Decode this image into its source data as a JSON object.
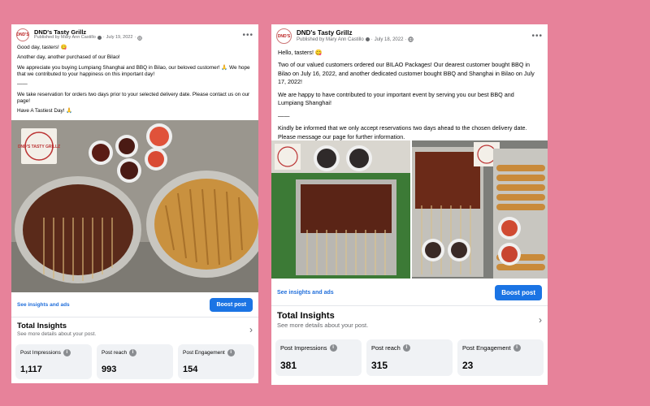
{
  "posts": [
    {
      "page_name": "DND's Tasty Grillz",
      "published_by": "Published by Mary Ann Castillo",
      "date": "July 19, 2022",
      "logo_text": "DND'S",
      "paragraphs": [
        "Good day, tasters! 😋",
        "Another day, another purchased of our Bilao!",
        "We appreciate you buying Lumpiang Shanghai and BBQ in Bilao, our beloved customer! 🙏 We hope that we contributed to your happiness on this important day!",
        "——",
        "We take reservation for orders two days prior to your selected delivery date. Please contact us on our page!",
        "Have A Tastiest Day! 🙏"
      ],
      "photo_logo_text": "DND'S TASTY GRILLZ",
      "see_insights": "See insights and ads",
      "boost_label": "Boost post",
      "total_title": "Total Insights",
      "total_sub": "See more details about your post.",
      "stats": [
        {
          "label": "Post Impressions",
          "value": "1,117"
        },
        {
          "label": "Post reach",
          "value": "993"
        },
        {
          "label": "Post Engagement",
          "value": "154"
        }
      ]
    },
    {
      "page_name": "DND's Tasty Grillz",
      "published_by": "Published by Mary Ann Castillo",
      "date": "July 18, 2022",
      "logo_text": "DND'S",
      "paragraphs": [
        "Hello, tasters! 😋",
        "Two of our valued customers ordered our BILAO Packages! Our dearest customer bought BBQ in Bilao on July 16, 2022, and another dedicated customer bought BBQ and Shanghai in Bilao on July 17, 2022!",
        "We are happy to have contributed to your important event by serving you our best BBQ and Lumpiang Shanghai!",
        "——",
        "Kindly be informed that we only accept reservations two days ahead to the chosen delivery date. Please message our page for further information."
      ],
      "photo_logo_text": "DND'S TASTY GRILLZ",
      "see_insights": "See insights and ads",
      "boost_label": "Boost post",
      "total_title": "Total Insights",
      "total_sub": "See more details about your post.",
      "stats": [
        {
          "label": "Post Impressions",
          "value": "381"
        },
        {
          "label": "Post reach",
          "value": "315"
        },
        {
          "label": "Post Engagement",
          "value": "23"
        }
      ]
    }
  ],
  "colors": {
    "background": "#e7829a",
    "boost": "#1b74e4",
    "link": "#216fdb"
  },
  "icons": [
    "globe-icon",
    "info-icon",
    "more-options-icon",
    "chevron-right-icon"
  ]
}
